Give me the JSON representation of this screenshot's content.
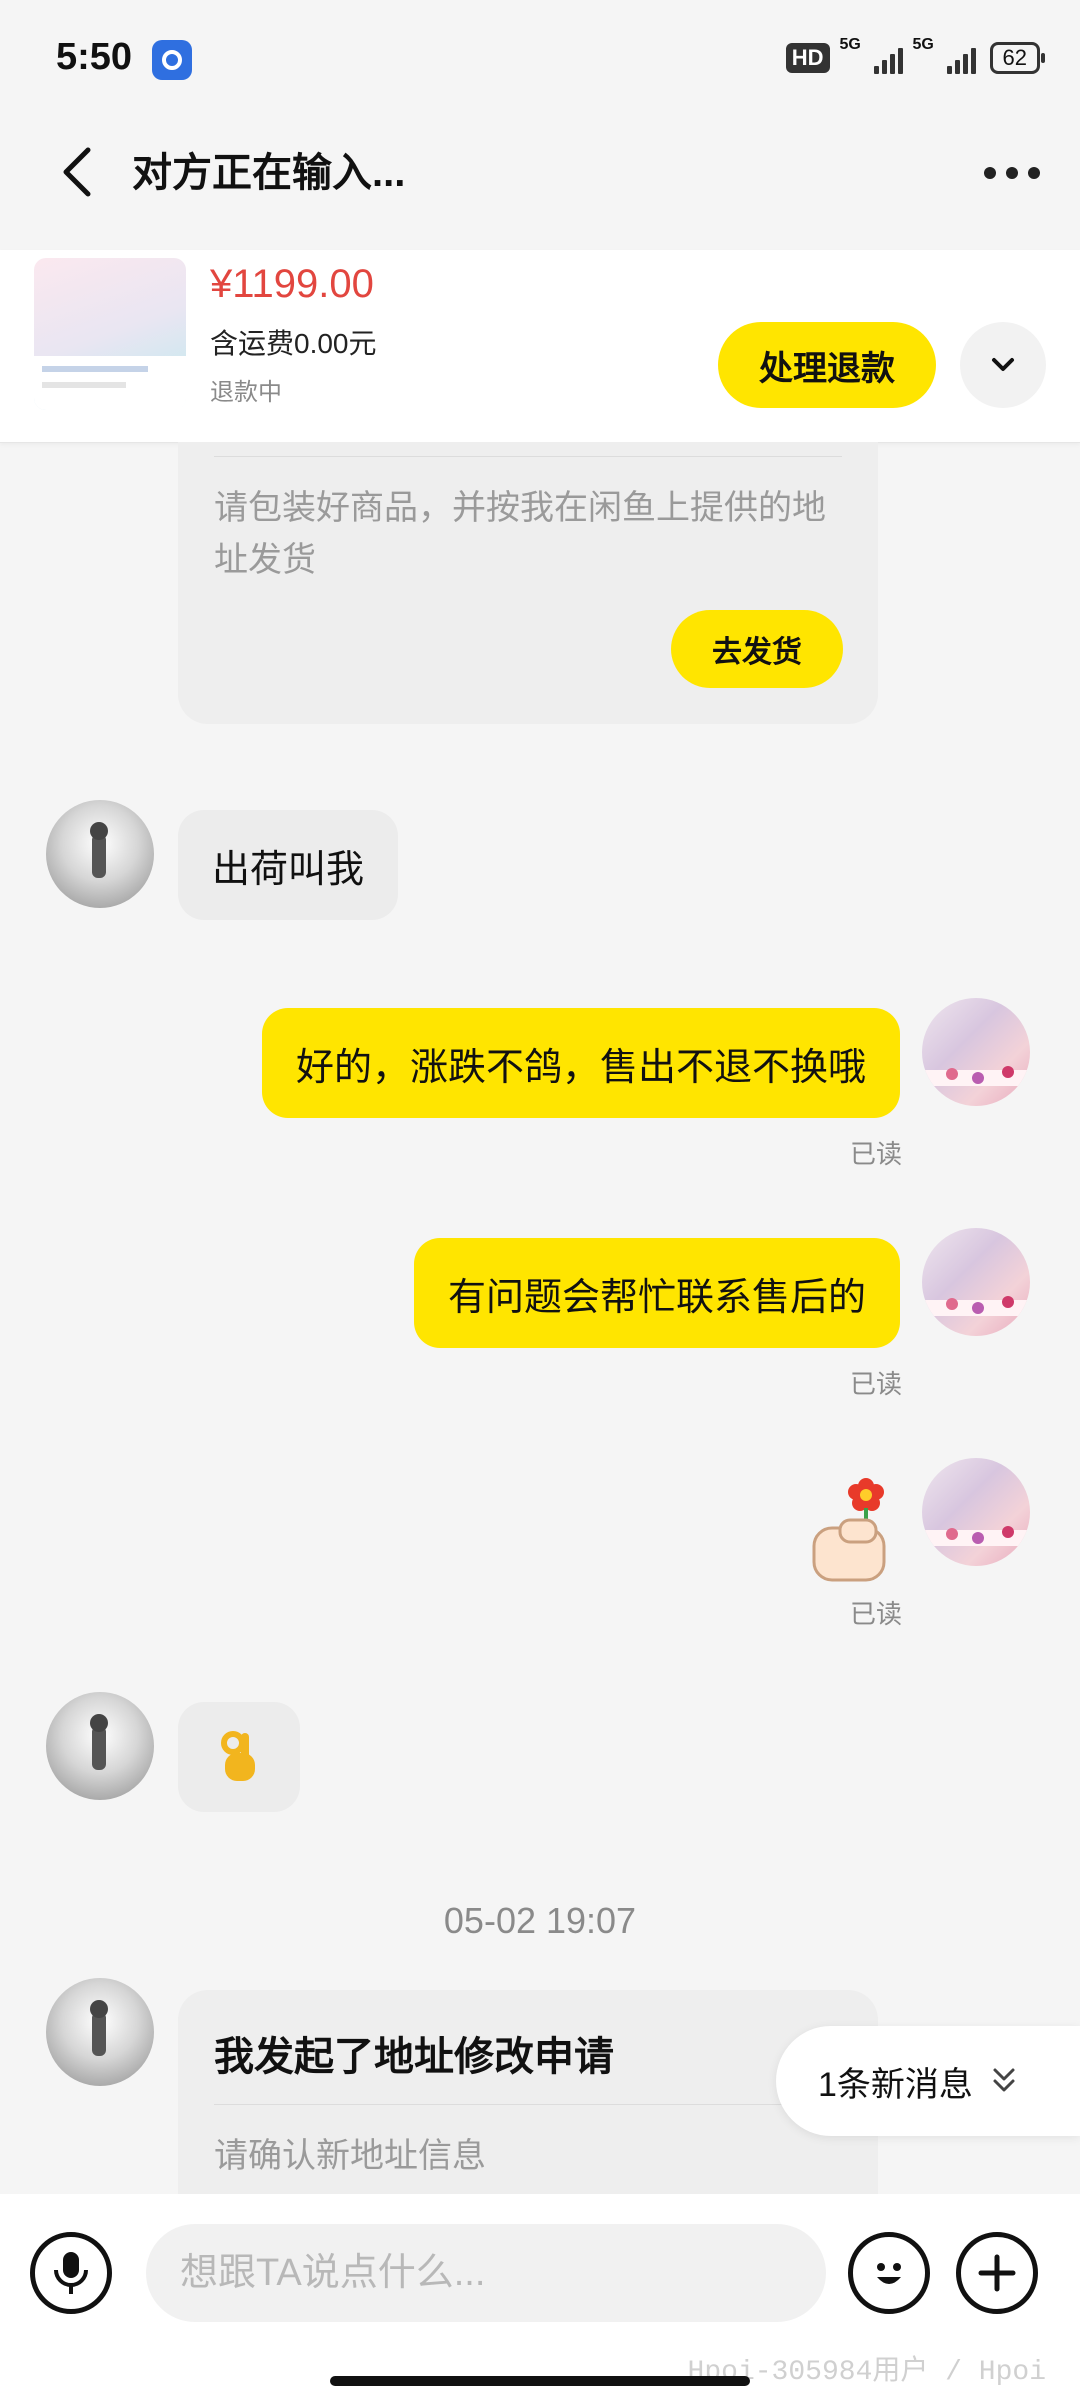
{
  "status_bar": {
    "time": "5:50",
    "hd_label": "HD",
    "sim1_label": "5G",
    "sim2_label": "5G",
    "battery": "62"
  },
  "header": {
    "title": "对方正在输入..."
  },
  "product": {
    "price": "¥1199.00",
    "shipping": "含运费0.00元",
    "status": "退款中",
    "refund_button": "处理退款"
  },
  "messages": {
    "card_top_text": "请包装好商品，并按我在闲鱼上提供的地址发货",
    "ship_button": "去发货",
    "msg1": "出荷叫我",
    "msg2": "好的，涨跌不鸽，售出不退不换哦",
    "msg2_read": "已读",
    "msg3": "有问题会帮忙联系售后的",
    "msg3_read": "已读",
    "msg4_read": "已读",
    "timestamp": "05-02 19:07",
    "card_bottom_title": "我发起了地址修改申请",
    "card_bottom_sub": "请确认新地址信息"
  },
  "new_message_pill": "1条新消息",
  "input": {
    "placeholder": "想跟TA说点什么..."
  },
  "watermark": "Hpoi-305984用户 / Hpoi",
  "colors": {
    "accent_yellow": "#ffe500",
    "price_red": "#e2463f"
  }
}
